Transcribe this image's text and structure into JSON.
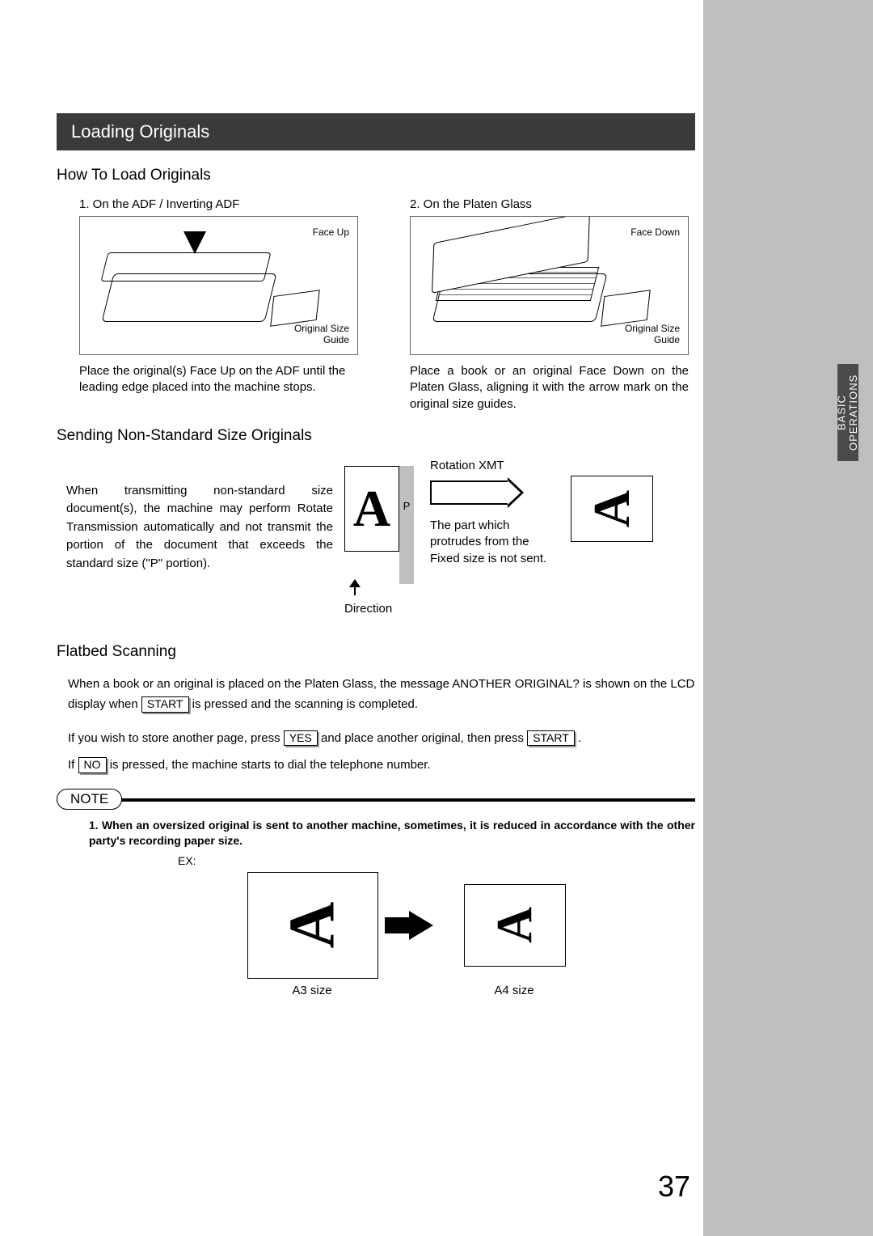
{
  "section_title": "Loading Originals",
  "sidebar_tab": "BASIC\nOPERATIONS",
  "how": {
    "heading": "How To Load Originals",
    "adf": {
      "title": "1. On the ADF / Inverting ADF",
      "label_face": "Face Up",
      "label_guide": "Original Size\nGuide",
      "text": "Place the original(s) Face Up on the ADF until the leading edge placed into the machine stops."
    },
    "platen": {
      "title": "2. On the Platen Glass",
      "label_face": "Face Down",
      "label_guide": "Original Size\nGuide",
      "text": "Place a book or an original Face Down on the Platen Glass, aligning it with the arrow mark on the original size guides."
    }
  },
  "nonstd": {
    "heading": "Sending Non-Standard Size Originals",
    "text": "When transmitting non-standard size document(s), the machine may perform Rotate Transmission automatically and not transmit the portion of the document that exceeds the standard size (\"P\" portion).",
    "letter": "A",
    "p_label": "P",
    "direction_label": "Direction",
    "rotation_label": "Rotation XMT",
    "protrude_text": "The part which protrudes from the Fixed size is not sent."
  },
  "flatbed": {
    "heading": "Flatbed Scanning",
    "line1a": "When a book or an original is placed on the Platen Glass, the message  ANOTHER ORIGINAL?  is shown on the LCD display when",
    "line1b": "is pressed and the scanning is completed.",
    "line2a": "If you wish to store another page, press",
    "line2b": "and place another original, then press",
    "line2c": ".",
    "line3a": "If",
    "line3b": "is pressed, the machine starts to dial the telephone number.",
    "btn_start": "START",
    "btn_yes": "YES",
    "btn_no": "NO"
  },
  "note": {
    "label": "NOTE",
    "text": "1. When an oversized original is sent to another machine, sometimes, it is reduced in accordance with the other party's recording paper size.",
    "ex_label": "EX:",
    "a3_label": "A3 size",
    "a4_label": "A4 size",
    "letter": "A"
  },
  "page_number": "37"
}
